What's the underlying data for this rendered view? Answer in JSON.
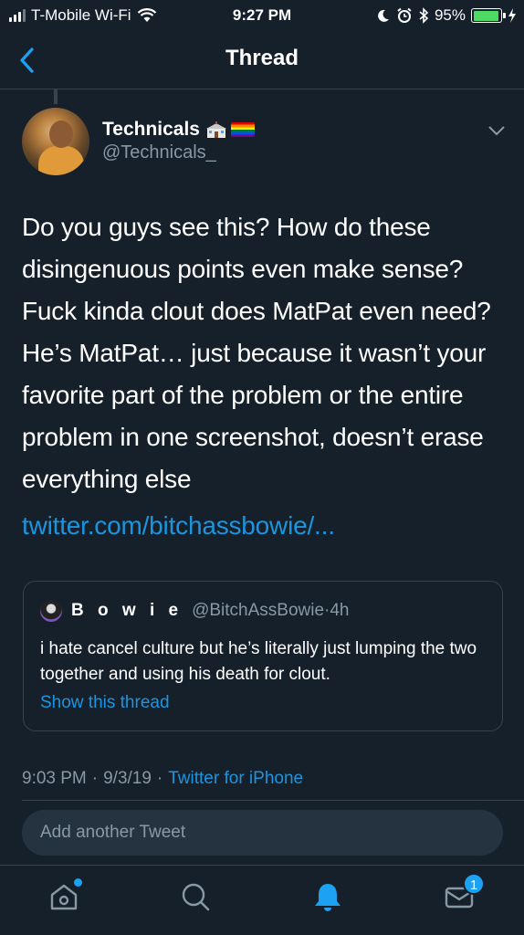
{
  "status_bar": {
    "carrier": "T-Mobile Wi-Fi",
    "time": "9:27 PM",
    "battery_percent": "95%",
    "battery_level": 0.95
  },
  "nav": {
    "title": "Thread"
  },
  "tweet": {
    "author_name": "Technicals",
    "author_emoji": "🏫🏳️‍🌈",
    "author_handle": "@Technicals_",
    "text": "Do you guys see this? How do these disingenuous points even make sense? Fuck kinda clout does MatPat even need? He’s MatPat… just because it wasn’t your favorite part of the problem or the entire problem in one screenshot, doesn’t erase everything else",
    "link": "twitter.com/bitchassbowie/...",
    "time": "9:03 PM",
    "date": "9/3/19",
    "source": "Twitter for iPhone",
    "separator": "·"
  },
  "quote": {
    "name": "B o w i e",
    "handle": "@BitchAssBowie",
    "age": "4h",
    "separator": "·",
    "text": "i hate cancel culture but he’s literally just lumping the two together and using his death for clout.",
    "show_thread": "Show this thread"
  },
  "compose": {
    "placeholder": "Add another Tweet"
  },
  "tabs": {
    "messages_badge": "1"
  },
  "colors": {
    "background": "#15202b",
    "accent": "#1b95e0",
    "secondary_text": "#8899a6",
    "border": "#38444d"
  }
}
